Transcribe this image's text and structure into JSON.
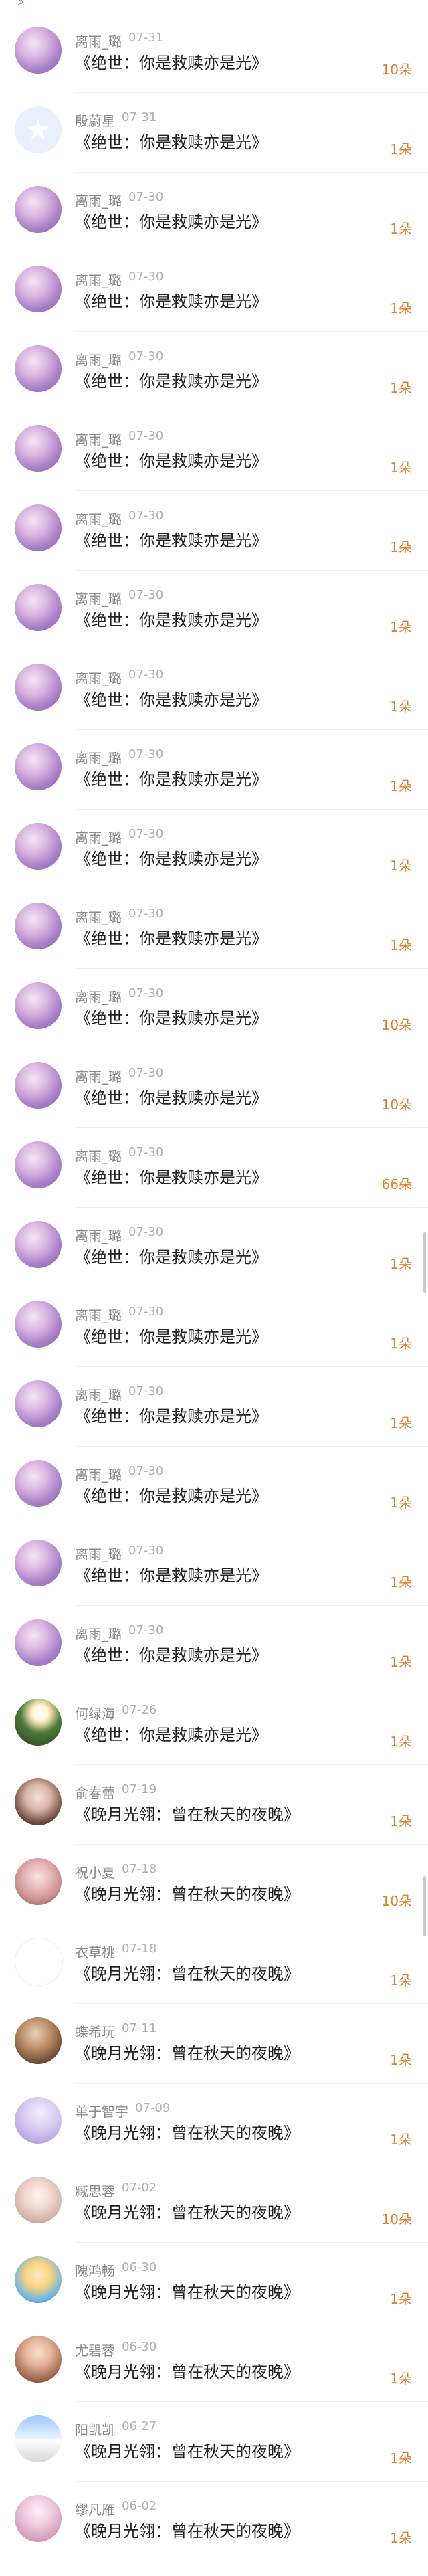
{
  "items": [
    {
      "name": "离雨_璐",
      "time": "07-31",
      "title": "《绝世：你是救赎亦是光》",
      "amount": "10朵",
      "avatar": "a1"
    },
    {
      "name": "殷蔚星",
      "time": "07-31",
      "title": "《绝世：你是救赎亦是光》",
      "amount": "1朵",
      "avatar": "a2"
    },
    {
      "name": "离雨_璐",
      "time": "07-30",
      "title": "《绝世：你是救赎亦是光》",
      "amount": "1朵",
      "avatar": "a1"
    },
    {
      "name": "离雨_璐",
      "time": "07-30",
      "title": "《绝世：你是救赎亦是光》",
      "amount": "1朵",
      "avatar": "a1"
    },
    {
      "name": "离雨_璐",
      "time": "07-30",
      "title": "《绝世：你是救赎亦是光》",
      "amount": "1朵",
      "avatar": "a1"
    },
    {
      "name": "离雨_璐",
      "time": "07-30",
      "title": "《绝世：你是救赎亦是光》",
      "amount": "1朵",
      "avatar": "a1"
    },
    {
      "name": "离雨_璐",
      "time": "07-30",
      "title": "《绝世：你是救赎亦是光》",
      "amount": "1朵",
      "avatar": "a1"
    },
    {
      "name": "离雨_璐",
      "time": "07-30",
      "title": "《绝世：你是救赎亦是光》",
      "amount": "1朵",
      "avatar": "a1"
    },
    {
      "name": "离雨_璐",
      "time": "07-30",
      "title": "《绝世：你是救赎亦是光》",
      "amount": "1朵",
      "avatar": "a1"
    },
    {
      "name": "离雨_璐",
      "time": "07-30",
      "title": "《绝世：你是救赎亦是光》",
      "amount": "1朵",
      "avatar": "a1"
    },
    {
      "name": "离雨_璐",
      "time": "07-30",
      "title": "《绝世：你是救赎亦是光》",
      "amount": "1朵",
      "avatar": "a1"
    },
    {
      "name": "离雨_璐",
      "time": "07-30",
      "title": "《绝世：你是救赎亦是光》",
      "amount": "1朵",
      "avatar": "a1"
    },
    {
      "name": "离雨_璐",
      "time": "07-30",
      "title": "《绝世：你是救赎亦是光》",
      "amount": "10朵",
      "avatar": "a1"
    },
    {
      "name": "离雨_璐",
      "time": "07-30",
      "title": "《绝世：你是救赎亦是光》",
      "amount": "10朵",
      "avatar": "a1"
    },
    {
      "name": "离雨_璐",
      "time": "07-30",
      "title": "《绝世：你是救赎亦是光》",
      "amount": "66朵",
      "avatar": "a1"
    },
    {
      "name": "离雨_璐",
      "time": "07-30",
      "title": "《绝世：你是救赎亦是光》",
      "amount": "1朵",
      "avatar": "a1"
    },
    {
      "name": "离雨_璐",
      "time": "07-30",
      "title": "《绝世：你是救赎亦是光》",
      "amount": "1朵",
      "avatar": "a1"
    },
    {
      "name": "离雨_璐",
      "time": "07-30",
      "title": "《绝世：你是救赎亦是光》",
      "amount": "1朵",
      "avatar": "a1"
    },
    {
      "name": "离雨_璐",
      "time": "07-30",
      "title": "《绝世：你是救赎亦是光》",
      "amount": "1朵",
      "avatar": "a1"
    },
    {
      "name": "离雨_璐",
      "time": "07-30",
      "title": "《绝世：你是救赎亦是光》",
      "amount": "1朵",
      "avatar": "a1"
    },
    {
      "name": "离雨_璐",
      "time": "07-30",
      "title": "《绝世：你是救赎亦是光》",
      "amount": "1朵",
      "avatar": "a1"
    },
    {
      "name": "何绿海",
      "time": "07-26",
      "title": "《绝世：你是救赎亦是光》",
      "amount": "1朵",
      "avatar": "a3"
    },
    {
      "name": "俞春蕾",
      "time": "07-19",
      "title": "《晚月光翎：曾在秋天的夜晚》",
      "amount": "1朵",
      "avatar": "a4"
    },
    {
      "name": "祝小夏",
      "time": "07-18",
      "title": "《晚月光翎：曾在秋天的夜晚》",
      "amount": "10朵",
      "avatar": "a5"
    },
    {
      "name": "衣草桃",
      "time": "07-18",
      "title": "《晚月光翎：曾在秋天的夜晚》",
      "amount": "1朵",
      "avatar": "a6"
    },
    {
      "name": "蝶希玩",
      "time": "07-11",
      "title": "《晚月光翎：曾在秋天的夜晚》",
      "amount": "1朵",
      "avatar": "a7"
    },
    {
      "name": "单于智宇",
      "time": "07-09",
      "title": "《晚月光翎：曾在秋天的夜晚》",
      "amount": "1朵",
      "avatar": "a8"
    },
    {
      "name": "臧思蓉",
      "time": "07-02",
      "title": "《晚月光翎：曾在秋天的夜晚》",
      "amount": "10朵",
      "avatar": "a9"
    },
    {
      "name": "隗鸿畅",
      "time": "06-30",
      "title": "《晚月光翎：曾在秋天的夜晚》",
      "amount": "1朵",
      "avatar": "a10"
    },
    {
      "name": "尤碧蓉",
      "time": "06-30",
      "title": "《晚月光翎：曾在秋天的夜晚》",
      "amount": "1朵",
      "avatar": "a11"
    },
    {
      "name": "阳凯凯",
      "time": "06-27",
      "title": "《晚月光翎：曾在秋天的夜晚》",
      "amount": "1朵",
      "avatar": "a12"
    },
    {
      "name": "缪凡雁",
      "time": "06-02",
      "title": "《晚月光翎：曾在秋天的夜晚》",
      "amount": "1朵",
      "avatar": "a13"
    }
  ],
  "scrollbar_positions": [
    0.49,
    0.74
  ]
}
